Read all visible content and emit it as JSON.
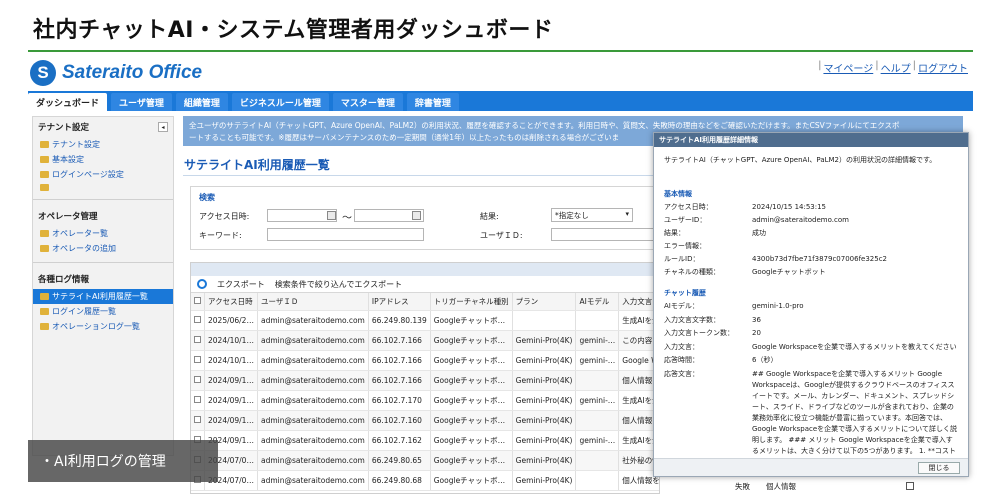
{
  "header": {
    "title": "社内チャットAI・システム管理者用ダッシュボード",
    "logo_mark": "S",
    "logo_text": "Sateraito Office"
  },
  "toplinks": [
    "マイページ",
    "ヘルプ",
    "ログアウト"
  ],
  "nav_tabs": [
    "ダッシュボード",
    "ユーザ管理",
    "組織管理",
    "ビジネスルール管理",
    "マスター管理",
    "辞書管理"
  ],
  "sidebar": {
    "tenant": {
      "heading": "テナント設定",
      "collapse": "◂",
      "items": [
        "テナント設定",
        "基本設定",
        "ログインページ設定",
        ""
      ]
    },
    "operator": {
      "heading": "オペレータ管理",
      "items": [
        "オペレーター覧",
        "オペレータの追加"
      ]
    },
    "logs": {
      "heading": "各種ログ情報",
      "items": [
        "サテライトAI利用履歴一覧",
        "ログイン履歴一覧",
        "オペレーションログ一覧"
      ]
    }
  },
  "notice": {
    "line1": "全ユーザのサテライトAI（チャットGPT、Azure OpenAI、PaLM2）の利用状況、履歴を確認することができます。利用日時や、質問文、失敗時の理由などをご確認いただけます。またCSVファイルにてエクスポ",
    "line2": "ートすることも可能です。※履歴はサーバメンテナンスのため一定期間（通常1年）以上たったものは削除される場合がございま"
  },
  "page_title": "サテライトAI利用履歴一覧",
  "search": {
    "heading": "検索",
    "access_date_label": "アクセス日時:",
    "range_sep": "〜",
    "keyword_label": "キーワード:",
    "result_label": "結果:",
    "result_value": "*指定なし",
    "userid_label": "ユーザＩＤ:"
  },
  "grid": {
    "toolbar": [
      "エクスポート",
      "検索条件で絞り込んでエクスポート"
    ],
    "columns": [
      "アクセス日時",
      "ユーザＩＤ",
      "IPアドレス",
      "トリガーチャネル種別",
      "プラン",
      "AIモデル",
      "入力文言"
    ],
    "rows": [
      [
        "2025/06/2…",
        "admin@sateraitodemo.com",
        "66.249.80.139",
        "Googleチャットボ…",
        "",
        "",
        "生成AIを企業で導入"
      ],
      [
        "2024/10/1…",
        "admin@sateraitodemo.com",
        "66.102.7.166",
        "Googleチャットボ…",
        "Gemini-Pro(4K)",
        "gemini-…",
        "この内容を表形式に"
      ],
      [
        "2024/10/1…",
        "admin@sateraitodemo.com",
        "66.102.7.166",
        "Googleチャットボ…",
        "Gemini-Pro(4K)",
        "gemini-…",
        "Google Workspace"
      ],
      [
        "2024/09/1…",
        "admin@sateraitodemo.com",
        "66.102.7.166",
        "Googleチャットボ…",
        "Gemini-Pro(4K)",
        "",
        "個人情報を調べる方"
      ],
      [
        "2024/09/1…",
        "admin@sateraitodemo.com",
        "66.102.7.170",
        "Googleチャットボ…",
        "Gemini-Pro(4K)",
        "gemini-…",
        "生成AIを企業で導入"
      ],
      [
        "2024/09/1…",
        "admin@sateraitodemo.com",
        "66.102.7.160",
        "Googleチャットボ…",
        "Gemini-Pro(4K)",
        "",
        "個人情報について教"
      ],
      [
        "2024/09/1…",
        "admin@sateraitodemo.com",
        "66.102.7.162",
        "Googleチャットボ…",
        "Gemini-Pro(4K)",
        "gemini-…",
        "生成AIを企業で導入"
      ],
      [
        "2024/07/0…",
        "admin@sateraitodemo.com",
        "66.249.80.65",
        "Googleチャットボ…",
        "Gemini-Pro(4K)",
        "",
        "社外秘の情報を抽出"
      ],
      [
        "2024/07/0…",
        "admin@sateraitodemo.com",
        "66.249.80.68",
        "Googleチャットボ…",
        "Gemini-Pro(4K)",
        "",
        "個人情報を調べる方法を教えてください"
      ]
    ],
    "behind_cells": [
      "失敗",
      "個人情報"
    ]
  },
  "dialog": {
    "title": "サテライトAI利用履歴詳細情報",
    "intro": "サテライトAI（チャットGPT、Azure OpenAI、PaLM2）の利用状況の詳細情報です。",
    "basic_heading": "基本情報",
    "basic": [
      {
        "label": "アクセス日時：",
        "value": "2024/10/15 14:53:15"
      },
      {
        "label": "ユーザーID：",
        "value": "admin@sateraitodemo.com"
      },
      {
        "label": "結果：",
        "value": "成功"
      },
      {
        "label": "エラー情報：",
        "value": ""
      },
      {
        "label": "ルールID：",
        "value": "4300b73d7fbe71f3879c07006fe325c2"
      },
      {
        "label": "チャネルの種類：",
        "value": "Googleチャットボット"
      }
    ],
    "chat_heading": "チャット履歴",
    "chat": [
      {
        "label": "AIモデル：",
        "value": "gemini-1.0-pro"
      },
      {
        "label": "入力文言文字数：",
        "value": "36"
      },
      {
        "label": "入力文言トークン数：",
        "value": "20"
      },
      {
        "label": "入力文言：",
        "value": "Google Workspaceを企業で導入するメリットを教えてください"
      },
      {
        "label": "応答時間：",
        "value": "6（秒）"
      },
      {
        "label": "応答文言：",
        "value": "## Google Workspaceを企業で導入するメリット Google Workspaceは、Googleが提供するクラウドベースのオフィススイートです。メール、カレンダー、ドキュメント、スプレッドシート、スライド、ドライブなどのツールが含まれており、企業の業務効率化に役立つ機能が豊富に揃っています。本回答では、Google Workspaceを企業で導入するメリットについて詳しく説明します。 ### メリット Google Workspaceを企業で導入するメリットは、大きく分けて以下の5つがあります。 1. **コスト削減:** Google Workspaceはクラウドベースのサービスであるため、ハードウェアやソフトウェアの購入やメンテナンス費用がかかりません。また、月額制のサブスクリプションモデルを採用しているため、初期投資を抑えることができます。"
      }
    ],
    "close_label": "閉じる"
  },
  "caption": "・AI利用ログの管理"
}
